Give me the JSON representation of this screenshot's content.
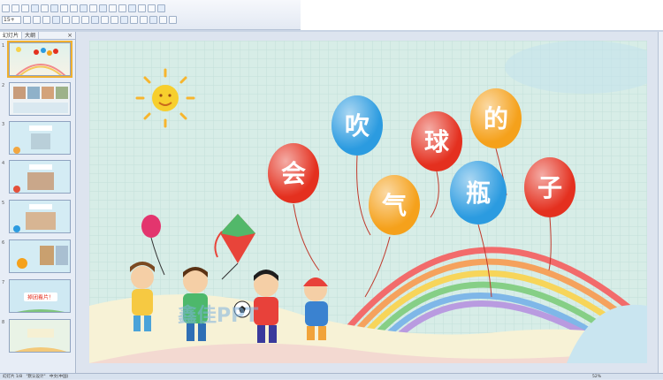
{
  "toolbar": {
    "font_size": "15+",
    "buttons_row1": [
      "new",
      "open",
      "save",
      "print",
      "preview",
      "spelling",
      "cut",
      "copy",
      "paste",
      "format-painter",
      "undo",
      "redo",
      "insert-chart",
      "insert-table",
      "insert-picture",
      "zoom",
      "help"
    ],
    "buttons_row2": [
      "bold",
      "italic",
      "underline",
      "shadow",
      "align-left",
      "align-center",
      "align-right",
      "bullets",
      "numbering",
      "increase-font",
      "decrease-font",
      "indent",
      "outdent",
      "font-color",
      "design",
      "new-slide"
    ]
  },
  "panel": {
    "tabs": [
      "幻灯片",
      "大纲"
    ],
    "close": "×",
    "slides": [
      {
        "num": "1"
      },
      {
        "num": "2"
      },
      {
        "num": "3"
      },
      {
        "num": "4"
      },
      {
        "num": "5"
      },
      {
        "num": "6"
      },
      {
        "num": "7"
      },
      {
        "num": "8"
      }
    ],
    "slide7_text": "掉团看片！"
  },
  "slide": {
    "balloons": [
      {
        "char": "会",
        "color": "#e4301f"
      },
      {
        "char": "吹",
        "color": "#2b9be0"
      },
      {
        "char": "气",
        "color": "#f5a11b"
      },
      {
        "char": "球",
        "color": "#e4301f"
      },
      {
        "char": "的",
        "color": "#f5a11b"
      },
      {
        "char": "瓶",
        "color": "#2b9be0"
      },
      {
        "char": "子",
        "color": "#e4301f"
      }
    ],
    "watermark": "鑫佳PPT"
  },
  "status": {
    "left": "幻灯片 1/8",
    "theme": "\"默认设计\"",
    "lang": "中文(中国)",
    "zoom": "52%"
  }
}
